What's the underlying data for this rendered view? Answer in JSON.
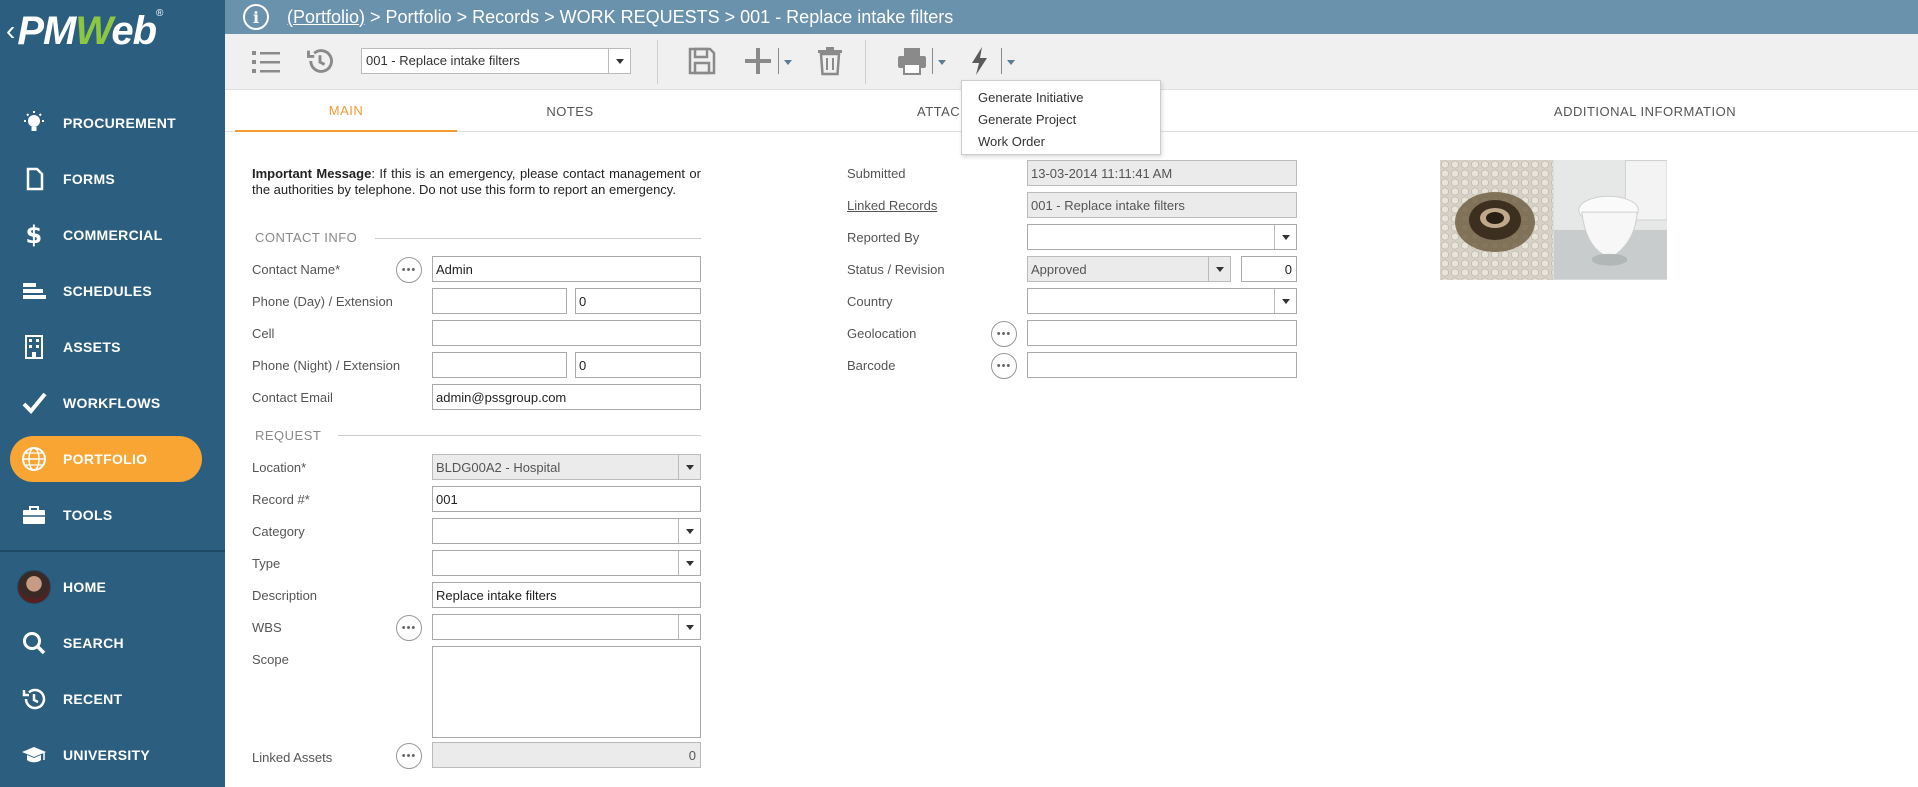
{
  "logo": {
    "text_pm": "PM",
    "text_w": "W",
    "text_eb": "eb",
    "reg": "®",
    "back": "‹"
  },
  "breadcrumb": {
    "link": "(Portfolio)",
    "rest": " > Portfolio > Records > WORK REQUESTS > 001 - Replace intake filters"
  },
  "nav": [
    {
      "label": "PROCUREMENT",
      "icon": "lightbulb-icon"
    },
    {
      "label": "FORMS",
      "icon": "document-icon"
    },
    {
      "label": "COMMERCIAL",
      "icon": "dollar-icon"
    },
    {
      "label": "SCHEDULES",
      "icon": "gantt-icon"
    },
    {
      "label": "ASSETS",
      "icon": "building-icon"
    },
    {
      "label": "WORKFLOWS",
      "icon": "checkmark-icon"
    },
    {
      "label": "PORTFOLIO",
      "icon": "globe-icon",
      "active": true
    },
    {
      "label": "TOOLS",
      "icon": "toolbox-icon"
    },
    {
      "label": "HOME",
      "icon": "avatar"
    },
    {
      "label": "SEARCH",
      "icon": "search-icon"
    },
    {
      "label": "RECENT",
      "icon": "history-icon"
    },
    {
      "label": "UNIVERSITY",
      "icon": "graduation-cap-icon"
    }
  ],
  "toolbar": {
    "record_selector": "001 - Replace intake filters"
  },
  "tabs": [
    "MAIN",
    "NOTES",
    "ATTACH",
    "ADDITIONAL INFORMATION"
  ],
  "action_menu": [
    "Generate Initiative",
    "Generate Project",
    "Work Order"
  ],
  "message": {
    "bold": "Important Message",
    "text": ": If this is an emergency, please contact management or the authorities by telephone. Do not use this form to report an emergency."
  },
  "contact": {
    "section": "CONTACT INFO",
    "name_label": "Contact Name*",
    "name": "Admin",
    "phone_day_label": "Phone (Day) / Extension",
    "phone_day": "",
    "phone_day_ext": "0",
    "cell_label": "Cell",
    "cell": "",
    "phone_night_label": "Phone (Night) / Extension",
    "phone_night": "",
    "phone_night_ext": "0",
    "email_label": "Contact Email",
    "email": "admin@pssgroup.com"
  },
  "request": {
    "section": "REQUEST",
    "location_label": "Location*",
    "location": "BLDG00A2 - Hospital",
    "record_label": "Record #*",
    "record": "001",
    "category_label": "Category",
    "category": "",
    "type_label": "Type",
    "type": "",
    "description_label": "Description",
    "description": "Replace intake filters",
    "wbs_label": "WBS",
    "wbs": "",
    "scope_label": "Scope",
    "scope": "",
    "linked_assets_label": "Linked Assets",
    "linked_assets": "0"
  },
  "right": {
    "submitted_label": "Submitted",
    "submitted": "13-03-2014 11:11:41 AM",
    "linked_records_label": "Linked Records",
    "linked_records": "001 - Replace intake filters",
    "reported_by_label": "Reported By",
    "reported_by": "",
    "status_label": "Status / Revision",
    "status": "Approved",
    "revision": "0",
    "country_label": "Country",
    "country": "",
    "geolocation_label": "Geolocation",
    "geolocation": "",
    "barcode_label": "Barcode",
    "barcode": ""
  },
  "colors": {
    "sidebar": "#2c5f7f",
    "topbar": "#6b92ad",
    "accent": "#f9a533",
    "tab_active": "#f29b2f"
  }
}
